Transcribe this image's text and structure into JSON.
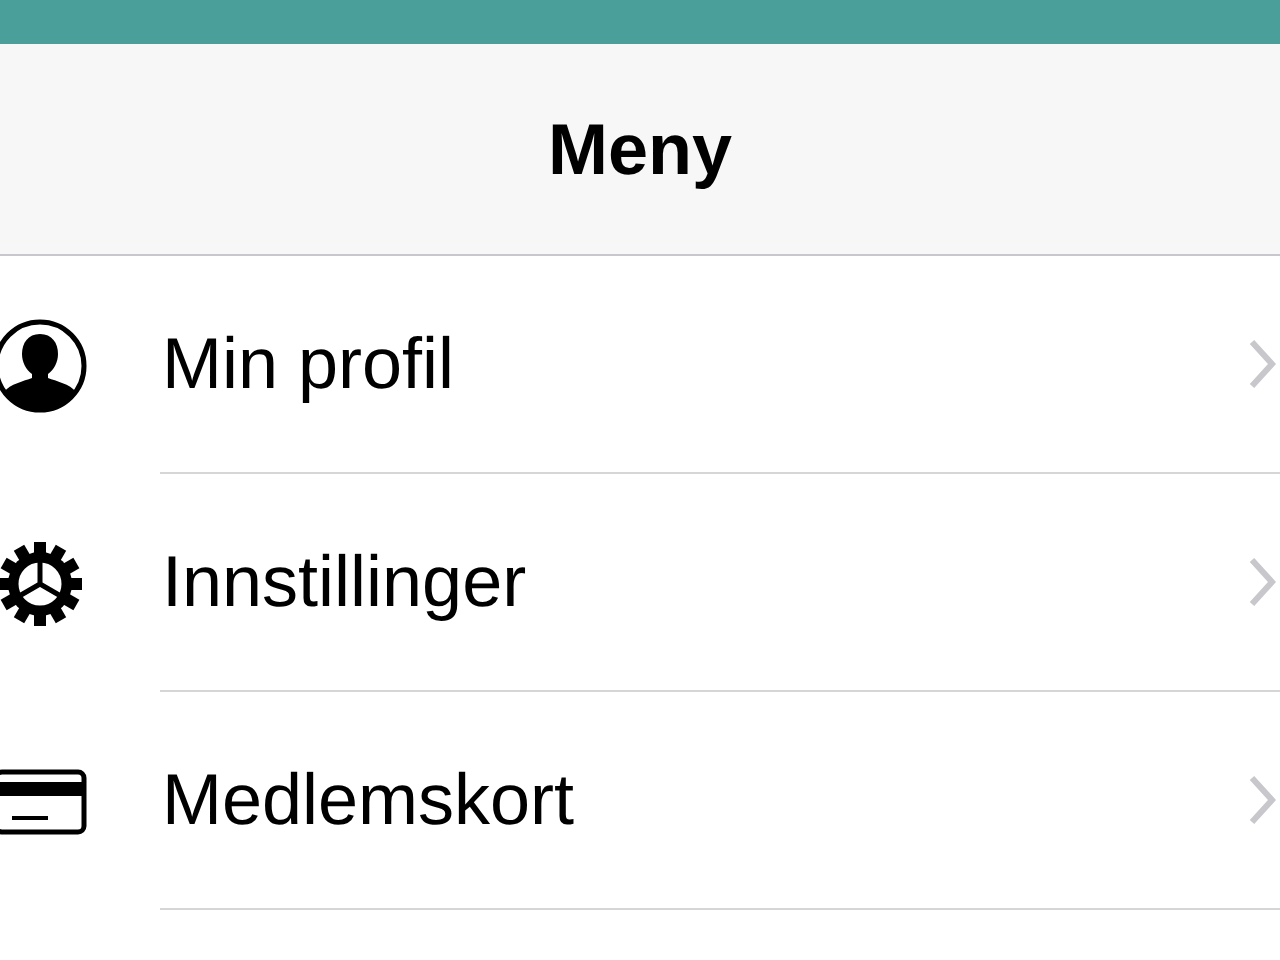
{
  "header": {
    "title": "Meny"
  },
  "menu_items": [
    {
      "label": "Min profil",
      "kind": "profile"
    },
    {
      "label": "Innstillinger",
      "kind": "settings"
    },
    {
      "label": "Medlemskort",
      "kind": "card"
    }
  ]
}
